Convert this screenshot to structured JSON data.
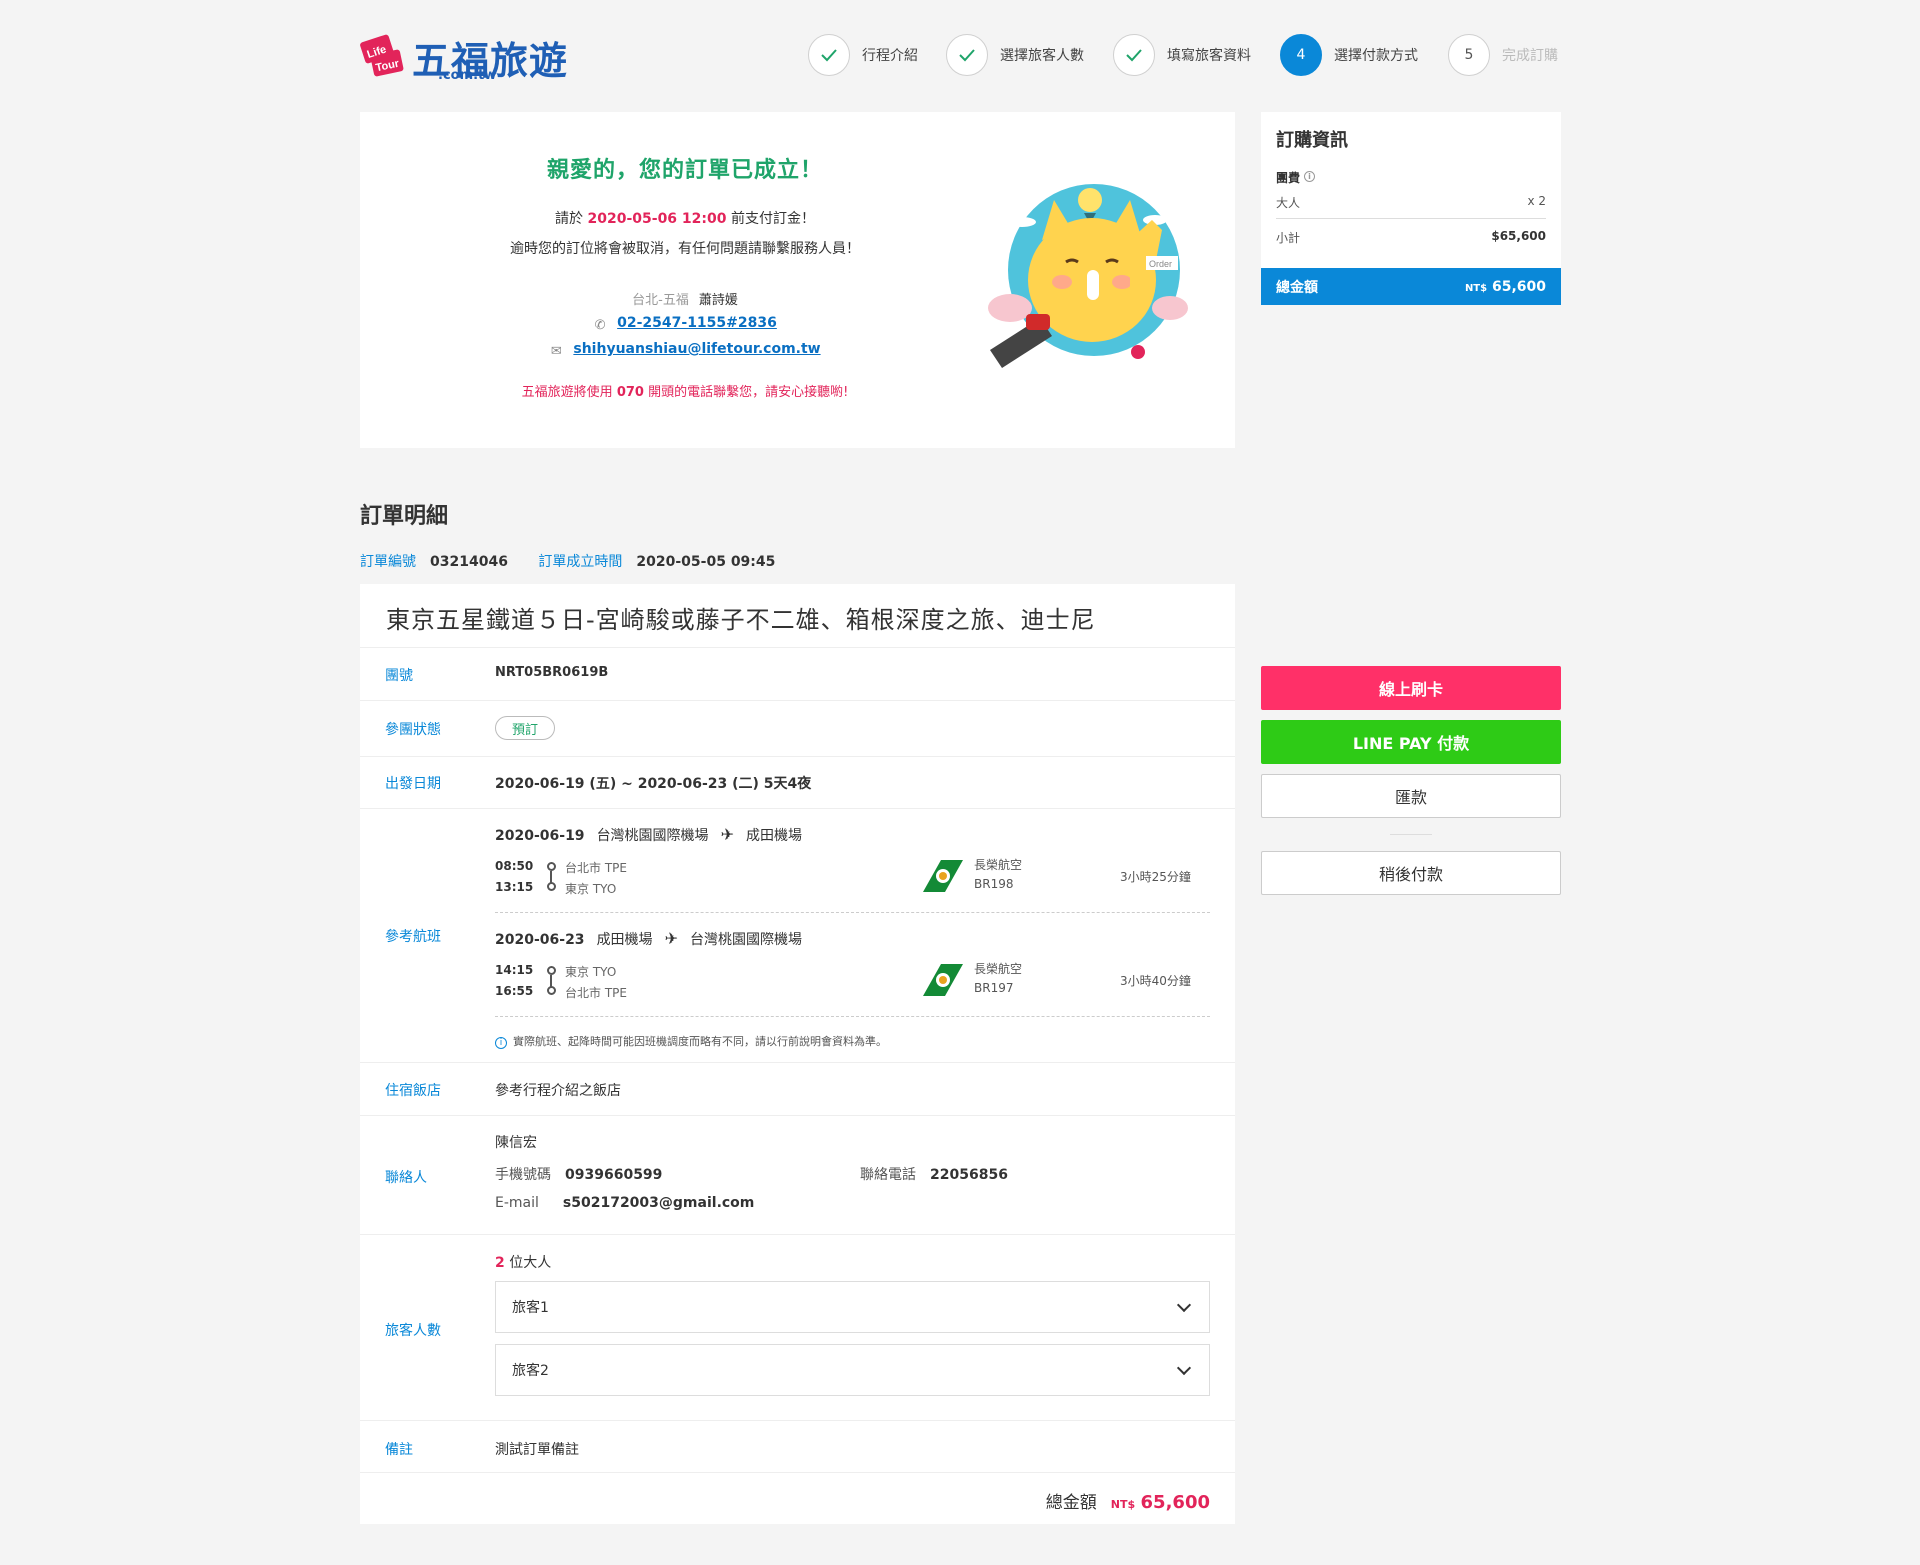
{
  "header": {
    "logo_badge": "LifeTour",
    "logo_text": "五福旅遊",
    "logo_domain": ".com.tw",
    "steps": [
      {
        "num": "",
        "label": "行程介紹",
        "state": "done"
      },
      {
        "num": "",
        "label": "選擇旅客人數",
        "state": "done"
      },
      {
        "num": "",
        "label": "填寫旅客資料",
        "state": "done"
      },
      {
        "num": "4",
        "label": "選擇付款方式",
        "state": "active"
      },
      {
        "num": "5",
        "label": "完成訂購",
        "state": "pending"
      }
    ]
  },
  "confirmation": {
    "title": "親愛的，您的訂單已成立！",
    "pay_prefix": "請於",
    "pay_deadline": "2020-05-06 12:00",
    "pay_suffix": "前支付訂金！",
    "cancel_notice": "逾時您的訂位將會被取消，有任何問題請聯繫服務人員！",
    "agent_branch": "台北-五福",
    "agent_name": "蕭詩媛",
    "phone": "02-2547-1155#2836",
    "email": "shihyuanshiau@lifetour.com.tw",
    "warn_prefix": "五福旅遊將使用",
    "warn_num": "070",
    "warn_suffix": "開頭的電話聯繫您，請安心接聽喲!",
    "illus_tag": "Order"
  },
  "sidebar": {
    "title": "訂購資訊",
    "fee_label": "團費",
    "adult_label": "大人",
    "adult_qty": "x 2",
    "subtotal_label": "小計",
    "subtotal_value": "$65,600",
    "total_label": "總金額",
    "total_currency": "NT$",
    "total_value": "65,600"
  },
  "payment": {
    "card": "線上刷卡",
    "linepay": "LINE PAY 付款",
    "bank": "匯款",
    "later": "稍後付款"
  },
  "detail": {
    "heading": "訂單明細",
    "order_no_label": "訂單編號",
    "order_no": "03214046",
    "created_label": "訂單成立時間",
    "created": "2020-05-05 09:45",
    "tour_title": "東京五星鐵道５日-宮崎駿或藤子不二雄、箱根深度之旅、迪士尼",
    "tour_code_label": "團號",
    "tour_code": "NRT05BR0619B",
    "status_label": "參團狀態",
    "status": "預訂",
    "depart_label": "出發日期",
    "depart": "2020-06-19 (五) ~ 2020-06-23 (二) 5天4夜",
    "flight_label": "參考航班",
    "flights": [
      {
        "date": "2020-06-19",
        "from": "台灣桃園國際機場",
        "to": "成田機場",
        "dep_time": "08:50",
        "dep_city": "台北市 TPE",
        "arr_time": "13:15",
        "arr_city": "東京 TYO",
        "airline": "長榮航空",
        "flight_no": "BR198",
        "duration": "3小時25分鐘"
      },
      {
        "date": "2020-06-23",
        "from": "成田機場",
        "to": "台灣桃園國際機場",
        "dep_time": "14:15",
        "dep_city": "東京 TYO",
        "arr_time": "16:55",
        "arr_city": "台北市 TPE",
        "airline": "長榮航空",
        "flight_no": "BR197",
        "duration": "3小時40分鐘"
      }
    ],
    "flight_note": "實際航班、起降時間可能因班機調度而略有不同，請以行前說明會資料為準。",
    "hotel_label": "住宿飯店",
    "hotel": "參考行程介紹之飯店",
    "contact_label": "聯絡人",
    "contact_name": "陳信宏",
    "mobile_label": "手機號碼",
    "mobile": "0939660599",
    "tel_label": "聯絡電話",
    "tel": "22056856",
    "email_label": "E-mail",
    "email": "s502172003@gmail.com",
    "pax_label": "旅客人數",
    "pax_count": "2",
    "pax_unit": "位大人",
    "travelers": [
      "旅客1",
      "旅客2"
    ],
    "remark_label": "備註",
    "remark": "測試訂單備註",
    "total_label": "總金額",
    "total_currency": "NT$",
    "total_value": "65,600"
  },
  "colors": {
    "brand": "#1f5fb5",
    "accent": "#0a88d8",
    "success": "#1fa46a",
    "alert": "#e2245a",
    "card_btn": "#ff3068",
    "line_btn": "#2ecb16"
  }
}
